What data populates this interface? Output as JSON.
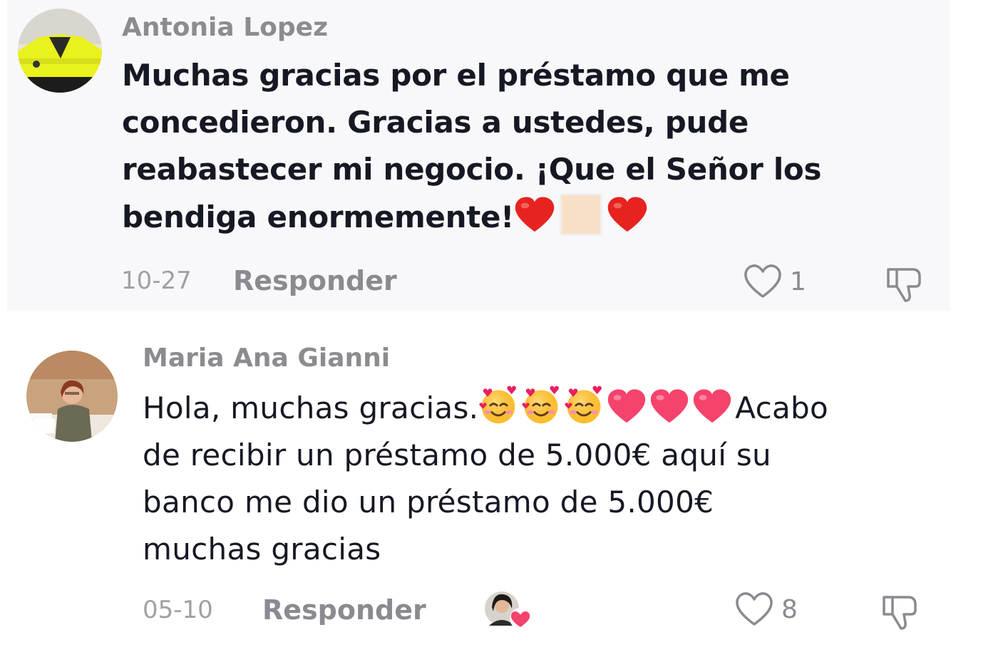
{
  "comments": [
    {
      "username": "Antonia Lopez",
      "avatar_icon": "avatar-yellow-jacket",
      "text_lines": [
        "Muchas gracias por el préstamo que me",
        "concedieron. Gracias a ustedes, pude",
        "reabastecer mi negocio. ¡Que el Señor los",
        "bendiga enormemente!"
      ],
      "emojis": [
        "red-heart",
        "skin-tone-square",
        "red-heart"
      ],
      "date": "10-27",
      "reply_label": "Responder",
      "like_count": "1"
    },
    {
      "username": "Maria Ana Gianni",
      "avatar_icon": "avatar-woman-desk",
      "text_lines": [
        "Hola, muchas gracias.",
        "de recibir un préstamo de 5.000€ aquí su",
        "banco me dio un préstamo de 5.000€",
        "muchas gracias"
      ],
      "text_line1_after_emojis": "Acabo",
      "emojis": [
        "smiling-face-with-hearts",
        "smiling-face-with-hearts",
        "smiling-face-with-hearts",
        "pink-heart",
        "pink-heart",
        "pink-heart"
      ],
      "date": "05-10",
      "reply_label": "Responder",
      "like_count": "8",
      "creator_liked": true
    }
  ],
  "colors": {
    "username": "#8c8c90",
    "text": "#161823",
    "meta": "#a0a0a6",
    "heart_red": "#e6231f",
    "heart_pink": "#f4436c",
    "highlight_bg": "#f8f8fa"
  }
}
